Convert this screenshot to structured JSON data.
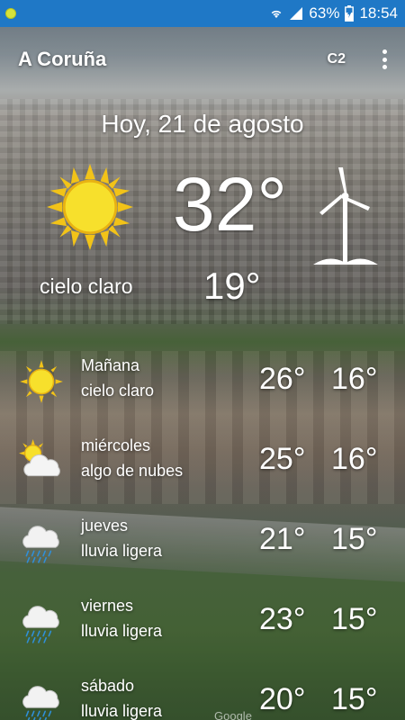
{
  "status_bar": {
    "battery": "63%",
    "time": "18:54",
    "colors": {
      "bar": "#1f78c6",
      "notification_dot": "#d6e23a"
    },
    "icons": [
      "notification-dot-icon",
      "wifi-icon",
      "signal-icon",
      "battery-charging-icon"
    ]
  },
  "toolbar": {
    "city": "A Coruña",
    "unit": "C2",
    "menu_icon": "more-vertical-icon"
  },
  "today": {
    "date": "Hoy, 21 de agosto",
    "icon": "sun-icon",
    "description": "cielo claro",
    "temp_max": "32°",
    "temp_min": "19°",
    "wind_icon": "wind-turbine-icon"
  },
  "forecast": [
    {
      "day": "Mañana",
      "condition": "cielo claro",
      "max": "26°",
      "min": "16°",
      "icon": "sun-icon"
    },
    {
      "day": "miércoles",
      "condition": "algo de nubes",
      "max": "25°",
      "min": "16°",
      "icon": "partly-cloudy-icon"
    },
    {
      "day": "jueves",
      "condition": "lluvia ligera",
      "max": "21°",
      "min": "15°",
      "icon": "light-rain-icon"
    },
    {
      "day": "viernes",
      "condition": "lluvia ligera",
      "max": "23°",
      "min": "15°",
      "icon": "light-rain-icon"
    },
    {
      "day": "sábado",
      "condition": "lluvia ligera",
      "max": "20°",
      "min": "15°",
      "icon": "light-rain-icon"
    }
  ],
  "watermark": "Google"
}
